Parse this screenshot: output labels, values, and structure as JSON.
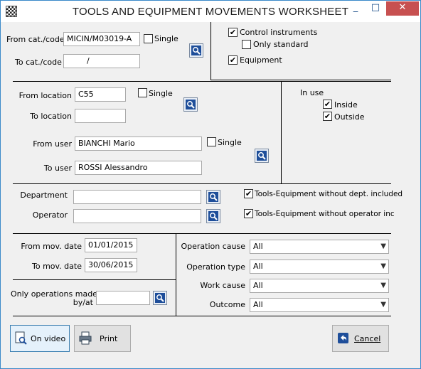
{
  "window": {
    "title": "TOOLS AND EQUIPMENT MOVEMENTS WORKSHEET",
    "min_glyph": "_",
    "max_glyph": "□",
    "close_glyph": "✕"
  },
  "cat": {
    "from_label": "From cat./code",
    "from_value": "MICIN/M03019-A",
    "to_label": "To cat./code",
    "to_value": "/",
    "single_label": "Single",
    "single_checked": false
  },
  "control": {
    "instruments_label": "Control instruments",
    "instruments_checked": true,
    "only_standard_label": "Only standard",
    "only_standard_checked": false,
    "equipment_label": "Equipment",
    "equipment_checked": true
  },
  "location": {
    "from_label": "From location",
    "from_value": "C55",
    "to_label": "To location",
    "to_value": "",
    "single_label": "Single",
    "single_checked": false
  },
  "in_use": {
    "label": "In use",
    "inside_label": "Inside",
    "inside_checked": true,
    "outside_label": "Outside",
    "outside_checked": true
  },
  "user": {
    "from_label": "From user",
    "from_value": "BIANCHI Mario",
    "to_label": "To user",
    "to_value": "ROSSI Alessandro",
    "single_label": "Single",
    "single_checked": false
  },
  "dept": {
    "department_label": "Department",
    "department_value": "",
    "operator_label": "Operator",
    "operator_value": "",
    "no_dept_label": "Tools-Equipment without dept. included",
    "no_dept_checked": true,
    "no_operator_label": "Tools-Equipment without operator included",
    "no_operator_checked": true
  },
  "dates": {
    "from_label": "From mov. date",
    "from_value": "01/01/2015",
    "to_label": "To mov. date",
    "to_value": "30/06/2015"
  },
  "only_ops": {
    "label_line1": "Only operations made",
    "label_line2": "by/at",
    "value": ""
  },
  "filters": {
    "operation_cause_label": "Operation cause",
    "operation_cause_value": "All",
    "operation_type_label": "Operation type",
    "operation_type_value": "All",
    "work_cause_label": "Work cause",
    "work_cause_value": "All",
    "outcome_label": "Outcome",
    "outcome_value": "All"
  },
  "buttons": {
    "on_video": "On video",
    "print": "Print",
    "cancel": "Cancel"
  },
  "colors": {
    "titlebar": "#ffffff",
    "close": "#c75050",
    "accent": "#1e4e9a"
  },
  "check_glyph": "✔"
}
